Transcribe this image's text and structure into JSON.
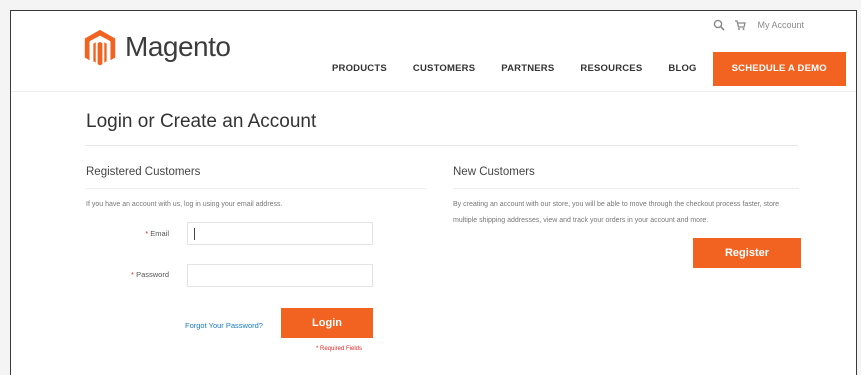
{
  "brand": {
    "name": "Magento",
    "accent": "#f26322"
  },
  "utility": {
    "search_icon": "search-icon",
    "cart_icon": "cart-icon",
    "account_label": "My Account"
  },
  "nav": {
    "items": [
      {
        "label": "PRODUCTS"
      },
      {
        "label": "CUSTOMERS"
      },
      {
        "label": "PARTNERS"
      },
      {
        "label": "RESOURCES"
      },
      {
        "label": "BLOG"
      }
    ],
    "cta": "SCHEDULE A DEMO"
  },
  "page": {
    "title": "Login or Create an Account"
  },
  "registered": {
    "title": "Registered Customers",
    "intro": "If you have an account with us, log in using your email address.",
    "email_label": "Email",
    "password_label": "Password",
    "email_value": "",
    "password_value": "",
    "forgot_label": "Forgot Your Password?",
    "login_label": "Login",
    "required_note": "* Required Fields"
  },
  "new_customers": {
    "title": "New Customers",
    "text": "By creating an account with our store, you will be able to move through the checkout process faster, store multiple shipping addresses, view and track your orders in your account and more.",
    "register_label": "Register"
  }
}
